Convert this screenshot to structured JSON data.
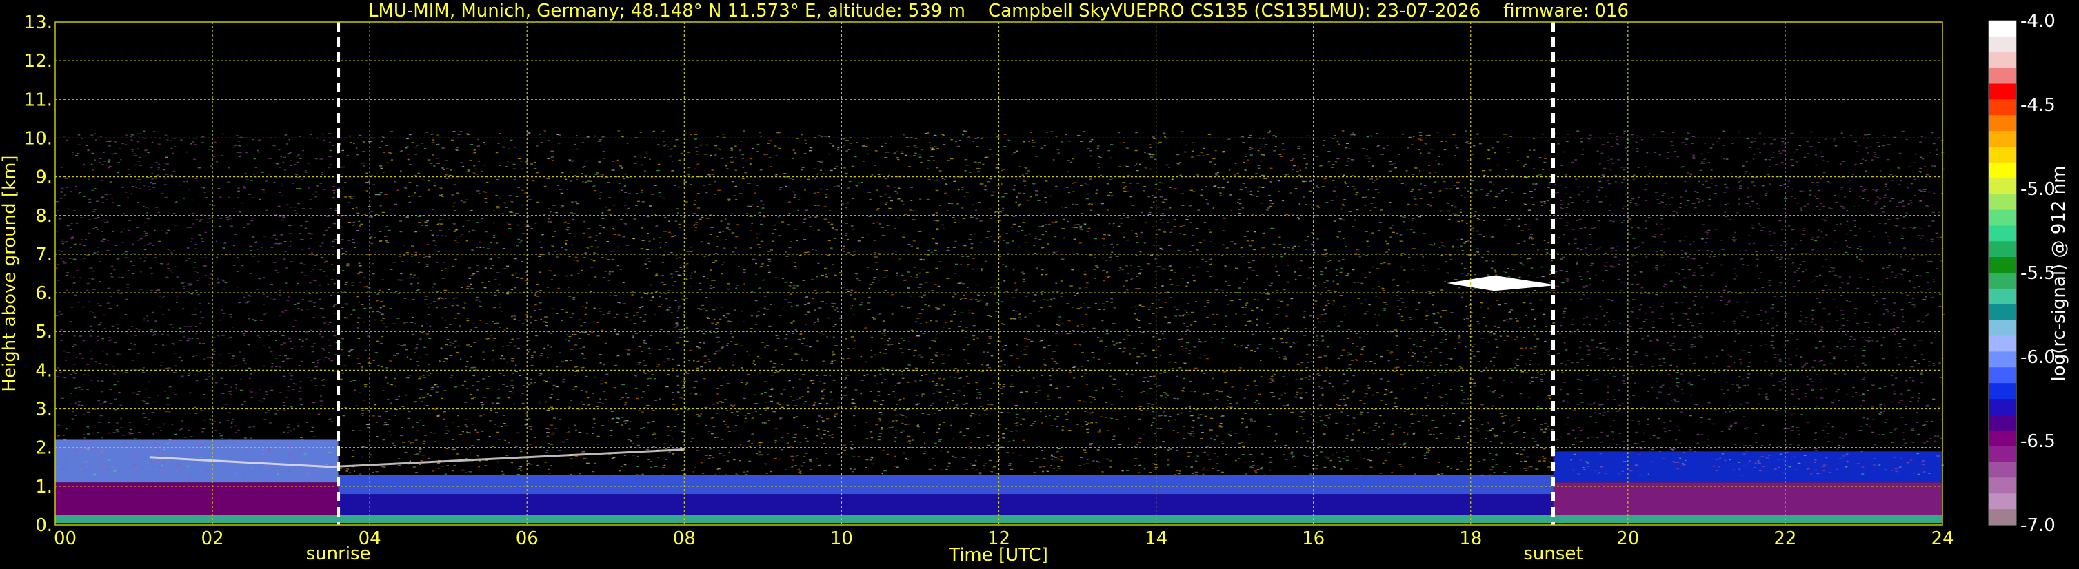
{
  "chart_data": {
    "type": "heatmap",
    "title": "LMU-MIM, Munich, Germany; 48.148° N 11.573° E, altitude: 539 m    Campbell SkyVUEPRO CS135 (CS135LMU): 23-07-2026    firmware: 016",
    "xlabel": "Time [UTC]",
    "ylabel": "Height above ground [km]",
    "xlim": [
      0,
      24
    ],
    "ylim": [
      0,
      13
    ],
    "x_ticks": [
      "00",
      "02",
      "04",
      "06",
      "08",
      "10",
      "12",
      "14",
      "16",
      "18",
      "20",
      "22",
      "24"
    ],
    "y_ticks": [
      "0.",
      "1.",
      "2.",
      "3.",
      "4.",
      "5.",
      "6.",
      "7.",
      "8.",
      "9.",
      "10.",
      "11.",
      "12.",
      "13."
    ],
    "grid": true,
    "colorbar": {
      "label": "log(rc-signal) @ 912 nm",
      "range": [
        -7.0,
        -4.0
      ],
      "ticks": [
        "-4.0",
        "-4.5",
        "-5.0",
        "-5.5",
        "-6.0",
        "-6.5",
        "-7.0"
      ],
      "colors": [
        "#ffffff",
        "#f0e6e6",
        "#f5c8c8",
        "#f08080",
        "#ff0000",
        "#ff4000",
        "#ff8000",
        "#ffb000",
        "#ffd800",
        "#ffff00",
        "#d8f040",
        "#a0e860",
        "#60e080",
        "#30d890",
        "#20b060",
        "#109010",
        "#30b060",
        "#40c8a0",
        "#109090",
        "#80c0e0",
        "#a0b4ff",
        "#7090ff",
        "#4060ff",
        "#1030e8",
        "#2010c0",
        "#500090",
        "#800080",
        "#902090",
        "#a050a0",
        "#b070b0",
        "#c090c0",
        "#a08090"
      ]
    },
    "annotations": [
      {
        "label": "sunrise",
        "x": 3.6
      },
      {
        "label": "sunset",
        "x": 19.05
      }
    ],
    "colors": {
      "text": "#ffff33",
      "grid": "#c8c800",
      "marker": "#ffffff",
      "background": "#000000"
    }
  }
}
